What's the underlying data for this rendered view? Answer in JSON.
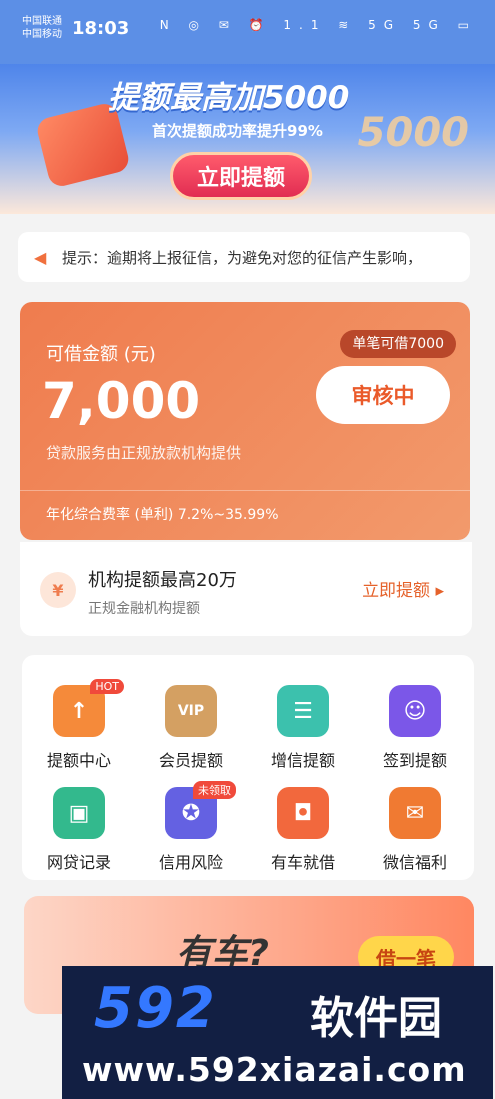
{
  "status": {
    "carrier1": "中国联通",
    "carrier2": "中国移动",
    "time": "18:03",
    "icons": "N ◎ ✉  ⏰ 1.1 ≋ 5G 5G ▭"
  },
  "banner": {
    "title": "提额最高加5000",
    "subtitle": "首次提额成功率提升99%",
    "num": "5000",
    "button": "立即提额"
  },
  "notice": {
    "text": "提示：逾期将上报征信，为避免对您的征信产生影响，"
  },
  "loan": {
    "label": "可借金额 (元)",
    "amount": "7,000",
    "provider": "贷款服务由正规放款机构提供",
    "tag": "单笔可借7000",
    "button": "审核中",
    "rate": "年化综合费率 (单利) 7.2%~35.99%"
  },
  "org": {
    "title": "机构提额最高20万",
    "subtitle": "正规金融机构提额",
    "button": "立即提额",
    "icon_text": "¥"
  },
  "grid": {
    "items": [
      {
        "label": "提额中心",
        "badge": "HOT"
      },
      {
        "label": "会员提额",
        "icon_text": "VIP"
      },
      {
        "label": "增信提额"
      },
      {
        "label": "签到提额"
      },
      {
        "label": "网贷记录"
      },
      {
        "label": "信用风险",
        "badge": "未领取"
      },
      {
        "label": "有车就借"
      },
      {
        "label": "微信福利"
      }
    ]
  },
  "promo": {
    "text": "有车?",
    "button": "借一笔"
  },
  "watermark": {
    "logo": "592",
    "cn": "软件园",
    "url": "www.592xiazai.com"
  }
}
